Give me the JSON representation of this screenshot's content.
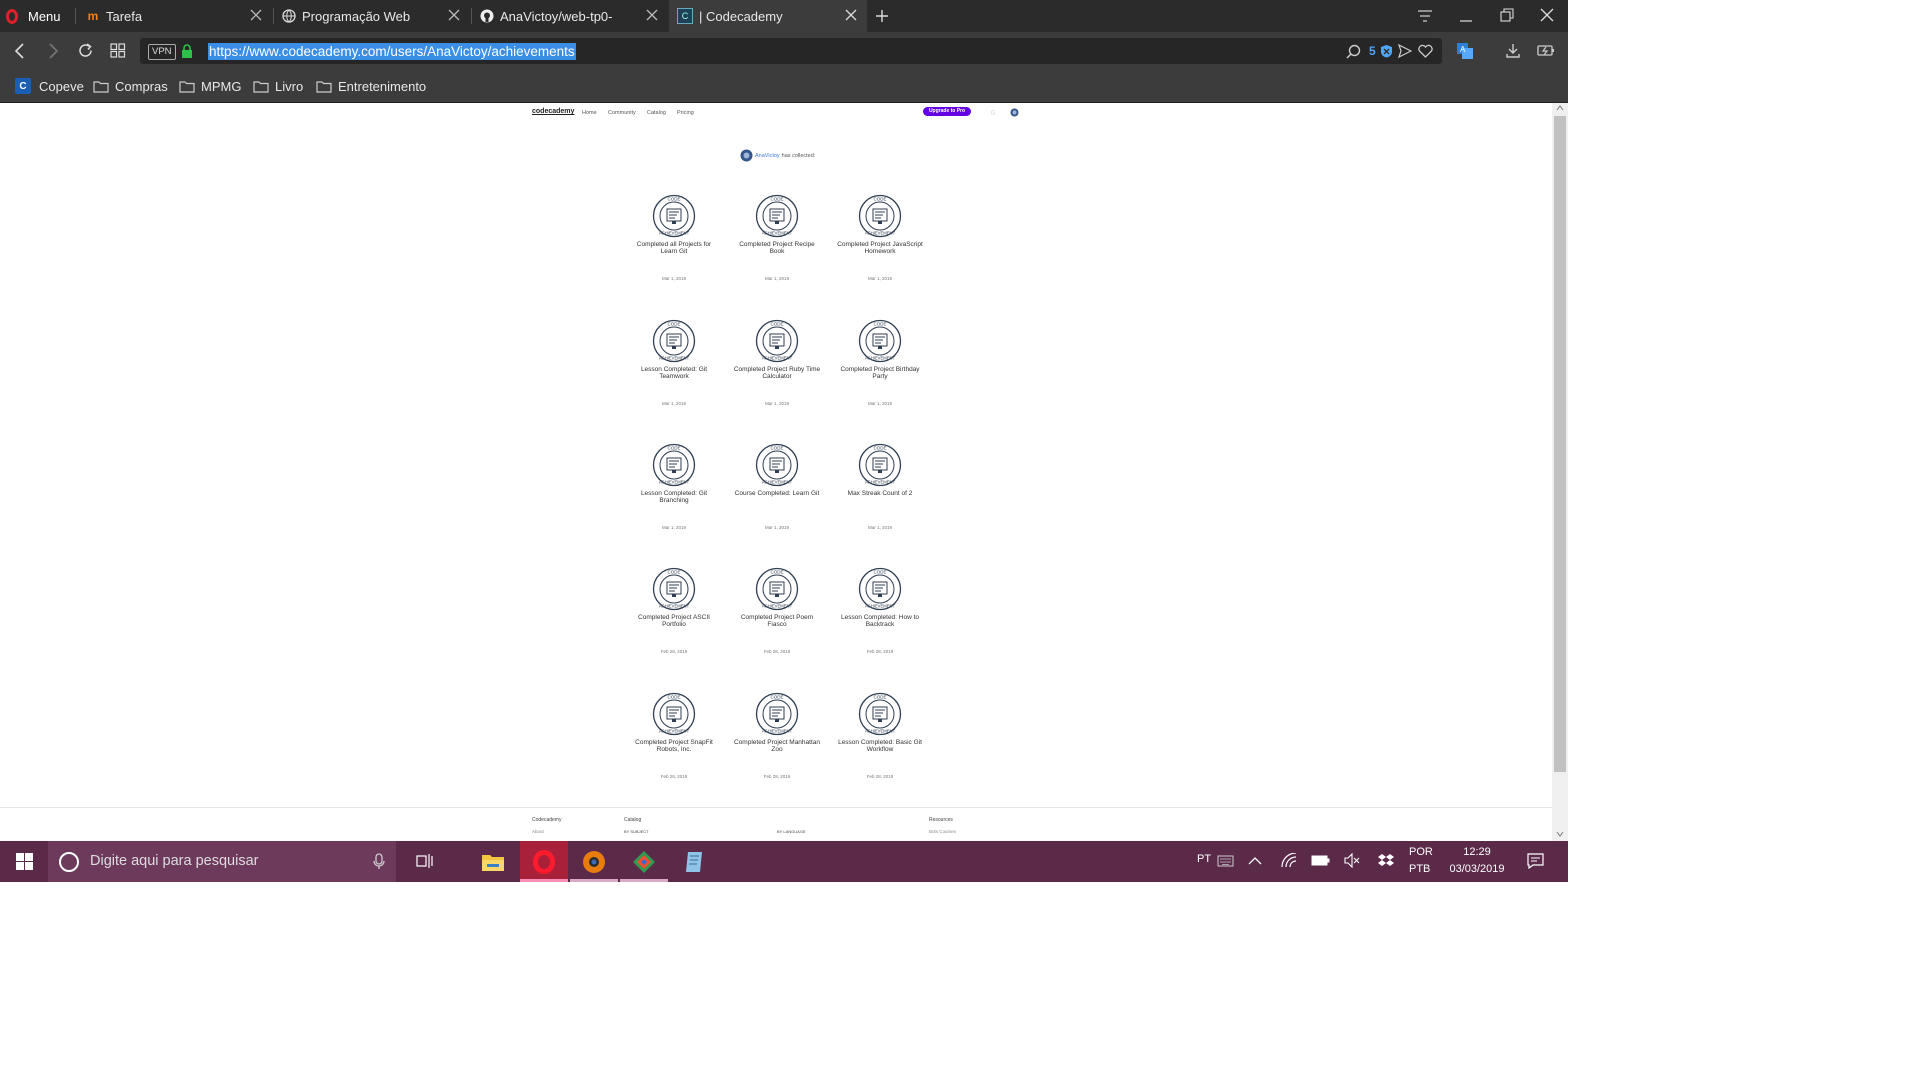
{
  "browser": {
    "menu_label": "Menu",
    "tabs": [
      {
        "label": "Tarefa"
      },
      {
        "label": "Programação Web"
      },
      {
        "label": "AnaVictoy/web-tp0-"
      },
      {
        "label": "| Codecademy"
      }
    ],
    "vpn_label": "VPN",
    "url": "https://www.codecademy.com/users/AnaVictoy/achievements",
    "badge_count": "5",
    "bookmarks": [
      {
        "label": "Copeve"
      },
      {
        "label": "Compras"
      },
      {
        "label": "MPMG"
      },
      {
        "label": "Livro"
      },
      {
        "label": "Entretenimento"
      }
    ]
  },
  "site": {
    "logo": "codecademy",
    "nav": [
      "Home",
      "Community",
      "Catalog",
      "Pricing"
    ],
    "upgrade_button": "Upgrade to Pro",
    "username": "AnaVictoy",
    "collected_text": "has collected:",
    "badge_lines": [
      "CODE",
      "ACHIEVEMENT"
    ],
    "achievements": [
      {
        "title": "Completed all Projects for Learn Git",
        "date": "Mar 1, 2019"
      },
      {
        "title": "Completed Project Recipe Book",
        "date": "Mar 1, 2019"
      },
      {
        "title": "Completed Project JavaScript Homework",
        "date": "Mar 1, 2019"
      },
      {
        "title": "Lesson Completed: Git Teamwork",
        "date": "Mar 1, 2019"
      },
      {
        "title": "Completed Project Ruby Time Calculator",
        "date": "Mar 1, 2019"
      },
      {
        "title": "Completed Project Birthday Party",
        "date": "Mar 1, 2019"
      },
      {
        "title": "Lesson Completed: Git Branching",
        "date": "Mar 1, 2019"
      },
      {
        "title": "Course Completed: Learn Git",
        "date": "Mar 1, 2019"
      },
      {
        "title": "Max Streak Count of 2",
        "date": "Mar 1, 2019"
      },
      {
        "title": "Completed Project ASCII Portfolio",
        "date": "Feb 28, 2019"
      },
      {
        "title": "Completed Project Poem Fiasco",
        "date": "Feb 28, 2019"
      },
      {
        "title": "Lesson Completed: How to Backtrack",
        "date": "Feb 28, 2019"
      },
      {
        "title": "Completed Project SnapFit Robots, Inc.",
        "date": "Feb 28, 2019"
      },
      {
        "title": "Completed Project Manhattan Zoo",
        "date": "Feb 28, 2019"
      },
      {
        "title": "Lesson Completed: Basic Git Workflow",
        "date": "Feb 28, 2019"
      }
    ],
    "footer": {
      "col1_title": "Codecademy",
      "col1_item": "About",
      "col2_title": "Catalog",
      "col2_sub": "BY SUBJECT",
      "col3_sub": "BY LANGUAGE",
      "col4_title": "Resources",
      "col4_item": "Bots Courses"
    }
  },
  "taskbar": {
    "search_placeholder": "Digite aqui para pesquisar",
    "lang_short": "PT",
    "lang": "POR",
    "layout": "PTB",
    "time": "12:29",
    "date": "03/03/2019"
  }
}
